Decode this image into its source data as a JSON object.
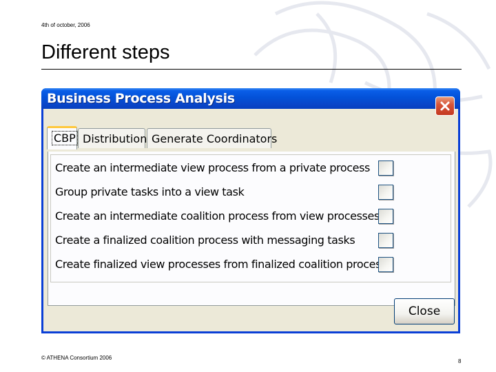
{
  "slide": {
    "date": "4th of october, 2006",
    "title": "Different steps",
    "footer_left": "© ATHENA Consortium 2006",
    "page_number": "8"
  },
  "dialog": {
    "title": "Business Process Analysis",
    "close_icon": "close-icon",
    "tabs": [
      {
        "label": "CBP",
        "active": true
      },
      {
        "label": "Distribution",
        "active": false
      },
      {
        "label": "Generate Coordinators",
        "active": false
      }
    ],
    "options": [
      {
        "label": "Create an intermediate view process from a private process",
        "checked": false
      },
      {
        "label": "Group private tasks into a view task",
        "checked": false
      },
      {
        "label": "Create an intermediate coalition process from view processes",
        "checked": false
      },
      {
        "label": "Create a finalized coalition process with messaging tasks",
        "checked": false
      },
      {
        "label": "Create finalized view processes from finalized coalition process",
        "checked": false
      }
    ],
    "close_button_label": "Close"
  },
  "colors": {
    "titlebar": "#0351d8",
    "dialog_bg": "#ece9d8",
    "active_tab_accent": "#ffc83c",
    "close_icon_bg": "#d8563a"
  }
}
